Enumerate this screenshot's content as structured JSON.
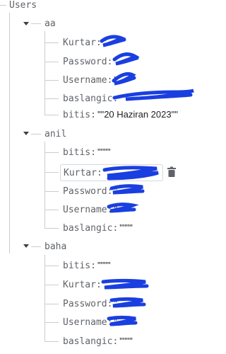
{
  "root": {
    "label": "Users"
  },
  "users": [
    {
      "name": "aa",
      "fields": [
        {
          "key": "Kurtar",
          "value": "\""
        },
        {
          "key": "Password",
          "value": "\""
        },
        {
          "key": "Username",
          "value": "\""
        },
        {
          "key": "baslangic",
          "value": "\""
        },
        {
          "key": "bitis",
          "value": "\"\"20 Haziran 2023\"\""
        }
      ]
    },
    {
      "name": "anil",
      "fields": [
        {
          "key": "bitis",
          "value": "\"\"\"\""
        },
        {
          "key": "Kurtar",
          "value": "\""
        },
        {
          "key": "Password",
          "value": "\""
        },
        {
          "key": "Username",
          "value": "\""
        },
        {
          "key": "baslangic",
          "value": "\"\"\"\""
        }
      ]
    },
    {
      "name": "baha",
      "fields": [
        {
          "key": "bitis",
          "value": "\"\"\"\""
        },
        {
          "key": "Kurtar",
          "value": "\""
        },
        {
          "key": "Password",
          "value": "\""
        },
        {
          "key": "Username",
          "value": "\""
        },
        {
          "key": "baslangic",
          "value": "\"\"\"\""
        }
      ]
    }
  ],
  "icons": {
    "delete": "trash-icon",
    "expand": "caret-down-icon"
  },
  "colors": {
    "redaction": "#1a3fe0",
    "tree_line": "#c9cdd2",
    "delete_icon": "#5f6368"
  }
}
